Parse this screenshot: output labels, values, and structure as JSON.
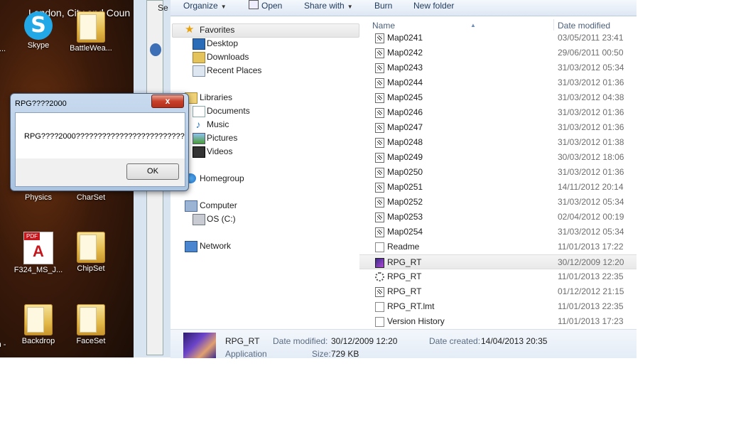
{
  "desktop": {
    "location_text": "London, City and Coun",
    "icons": [
      {
        "label": "Skype",
        "icon": "skype-icon"
      },
      {
        "label": "BattleWea...",
        "icon": "folder-icon"
      },
      {
        "label": "Physics",
        "icon": "folder-icon"
      },
      {
        "label": "CharSet",
        "icon": "folder-icon"
      },
      {
        "label": "F324_MS_J...",
        "icon": "pdf-icon"
      },
      {
        "label": "ChipSet",
        "icon": "folder-icon"
      },
      {
        "label": "Backdrop",
        "icon": "folder-icon"
      },
      {
        "label": "FaceSet",
        "icon": "folder-icon"
      }
    ],
    "edge_labels": [
      "t...",
      "n -"
    ]
  },
  "background_window": {
    "fragment": "Se"
  },
  "toolbar": {
    "organize": "Organize",
    "open": "Open",
    "share_with": "Share with",
    "burn": "Burn",
    "new_folder": "New folder"
  },
  "nav": {
    "favorites": "Favorites",
    "desktop": "Desktop",
    "downloads": "Downloads",
    "recent_places": "Recent Places",
    "libraries": "Libraries",
    "documents": "Documents",
    "music": "Music",
    "pictures": "Pictures",
    "videos": "Videos",
    "homegroup": "Homegroup",
    "computer": "Computer",
    "os_drive": "OS (C:)",
    "network": "Network"
  },
  "columns": {
    "name": "Name",
    "date_modified": "Date modified"
  },
  "files": [
    {
      "name": "Map0241",
      "date": "03/05/2011 23:41",
      "icon": "map-file-icon"
    },
    {
      "name": "Map0242",
      "date": "29/06/2011 00:50",
      "icon": "map-file-icon"
    },
    {
      "name": "Map0243",
      "date": "31/03/2012 05:34",
      "icon": "map-file-icon"
    },
    {
      "name": "Map0244",
      "date": "31/03/2012 01:36",
      "icon": "map-file-icon"
    },
    {
      "name": "Map0245",
      "date": "31/03/2012 04:38",
      "icon": "map-file-icon"
    },
    {
      "name": "Map0246",
      "date": "31/03/2012 01:36",
      "icon": "map-file-icon"
    },
    {
      "name": "Map0247",
      "date": "31/03/2012 01:36",
      "icon": "map-file-icon"
    },
    {
      "name": "Map0248",
      "date": "31/03/2012 01:38",
      "icon": "map-file-icon"
    },
    {
      "name": "Map0249",
      "date": "30/03/2012 18:06",
      "icon": "map-file-icon"
    },
    {
      "name": "Map0250",
      "date": "31/03/2012 01:36",
      "icon": "map-file-icon"
    },
    {
      "name": "Map0251",
      "date": "14/11/2012 20:14",
      "icon": "map-file-icon"
    },
    {
      "name": "Map0252",
      "date": "31/03/2012 05:34",
      "icon": "map-file-icon"
    },
    {
      "name": "Map0253",
      "date": "02/04/2012 00:19",
      "icon": "map-file-icon"
    },
    {
      "name": "Map0254",
      "date": "31/03/2012 05:34",
      "icon": "map-file-icon"
    },
    {
      "name": "Readme",
      "date": "11/01/2013 17:22",
      "icon": "text-file-icon"
    },
    {
      "name": "RPG_RT",
      "date": "30/12/2009 12:20",
      "icon": "application-icon",
      "selected": true
    },
    {
      "name": "RPG_RT",
      "date": "11/01/2013 22:35",
      "icon": "settings-file-icon"
    },
    {
      "name": "RPG_RT",
      "date": "01/12/2012 21:15",
      "icon": "map-file-icon"
    },
    {
      "name": "RPG_RT.lmt",
      "date": "11/01/2013 22:35",
      "icon": "text-file-icon"
    },
    {
      "name": "Version History",
      "date": "11/01/2013 17:23",
      "icon": "text-file-icon"
    }
  ],
  "details": {
    "name": "RPG_RT",
    "type": "Application",
    "date_modified_label": "Date modified:",
    "date_modified": "30/12/2009 12:20",
    "date_created_label": "Date created:",
    "date_created": "14/04/2013 20:35",
    "size_label": "Size:",
    "size": "729 KB"
  },
  "dialog": {
    "title": "RPG????2000",
    "message": "RPG????2000?????????????????????????",
    "ok": "OK",
    "close": "x"
  }
}
